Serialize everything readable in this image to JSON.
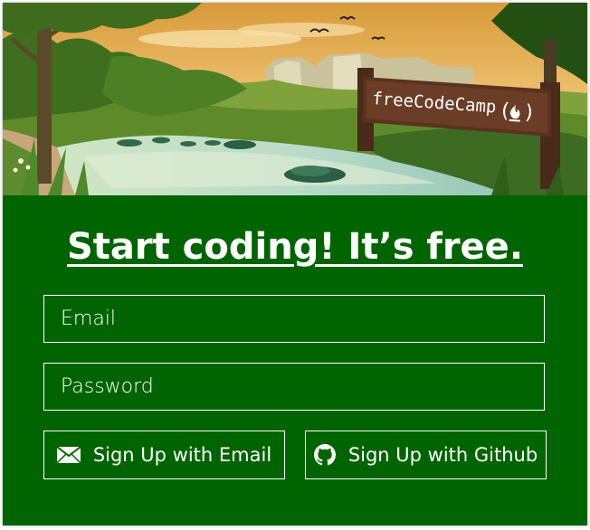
{
  "hero": {
    "sign_text": "freeCodeCamp",
    "sign_icon": "fire-icon"
  },
  "headline": "Start  coding! It’s free.",
  "form": {
    "email_placeholder": "Email",
    "password_placeholder": "Password",
    "email_button_label": "Sign Up with Email",
    "email_button_icon": "envelope-icon",
    "github_button_label": "Sign Up with Github",
    "github_button_icon": "github-icon"
  },
  "colors": {
    "panel_background": "#006400",
    "text": "#ffffff",
    "border": "#ffffff"
  }
}
